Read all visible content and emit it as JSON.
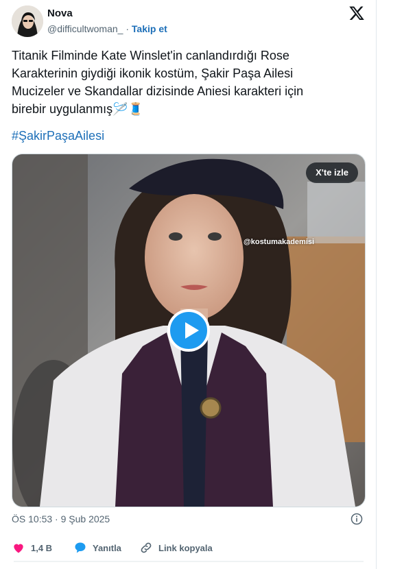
{
  "author": {
    "name": "Nova",
    "handle": "@difficultwoman_",
    "separator": "·",
    "follow_label": "Takip et"
  },
  "tweet": {
    "text": "Titanik Filminde Kate Winslet'in canlandırdığı Rose\nKarakterinin giydiği ikonik kostüm, Şakir Paşa Ailesi\nMucizeler ve Skandallar dizisinde Aniesi karakteri için\nbirebir uygulanmış🪡🧵",
    "hashtag": "#ŞakirPaşaAilesi",
    "timestamp": "ÖS 10:53 · 9 Şub 2025"
  },
  "media": {
    "watch_label": "X'te izle",
    "watermark": "@kostumakademisi"
  },
  "actions": {
    "likes": "1,4 B",
    "reply_label": "Yanıtla",
    "copy_link_label": "Link kopyala"
  },
  "colors": {
    "link": "#1d6fb8",
    "like": "#f91880",
    "play": "#1d9bf0",
    "reply_icon": "#1d9bf0"
  }
}
